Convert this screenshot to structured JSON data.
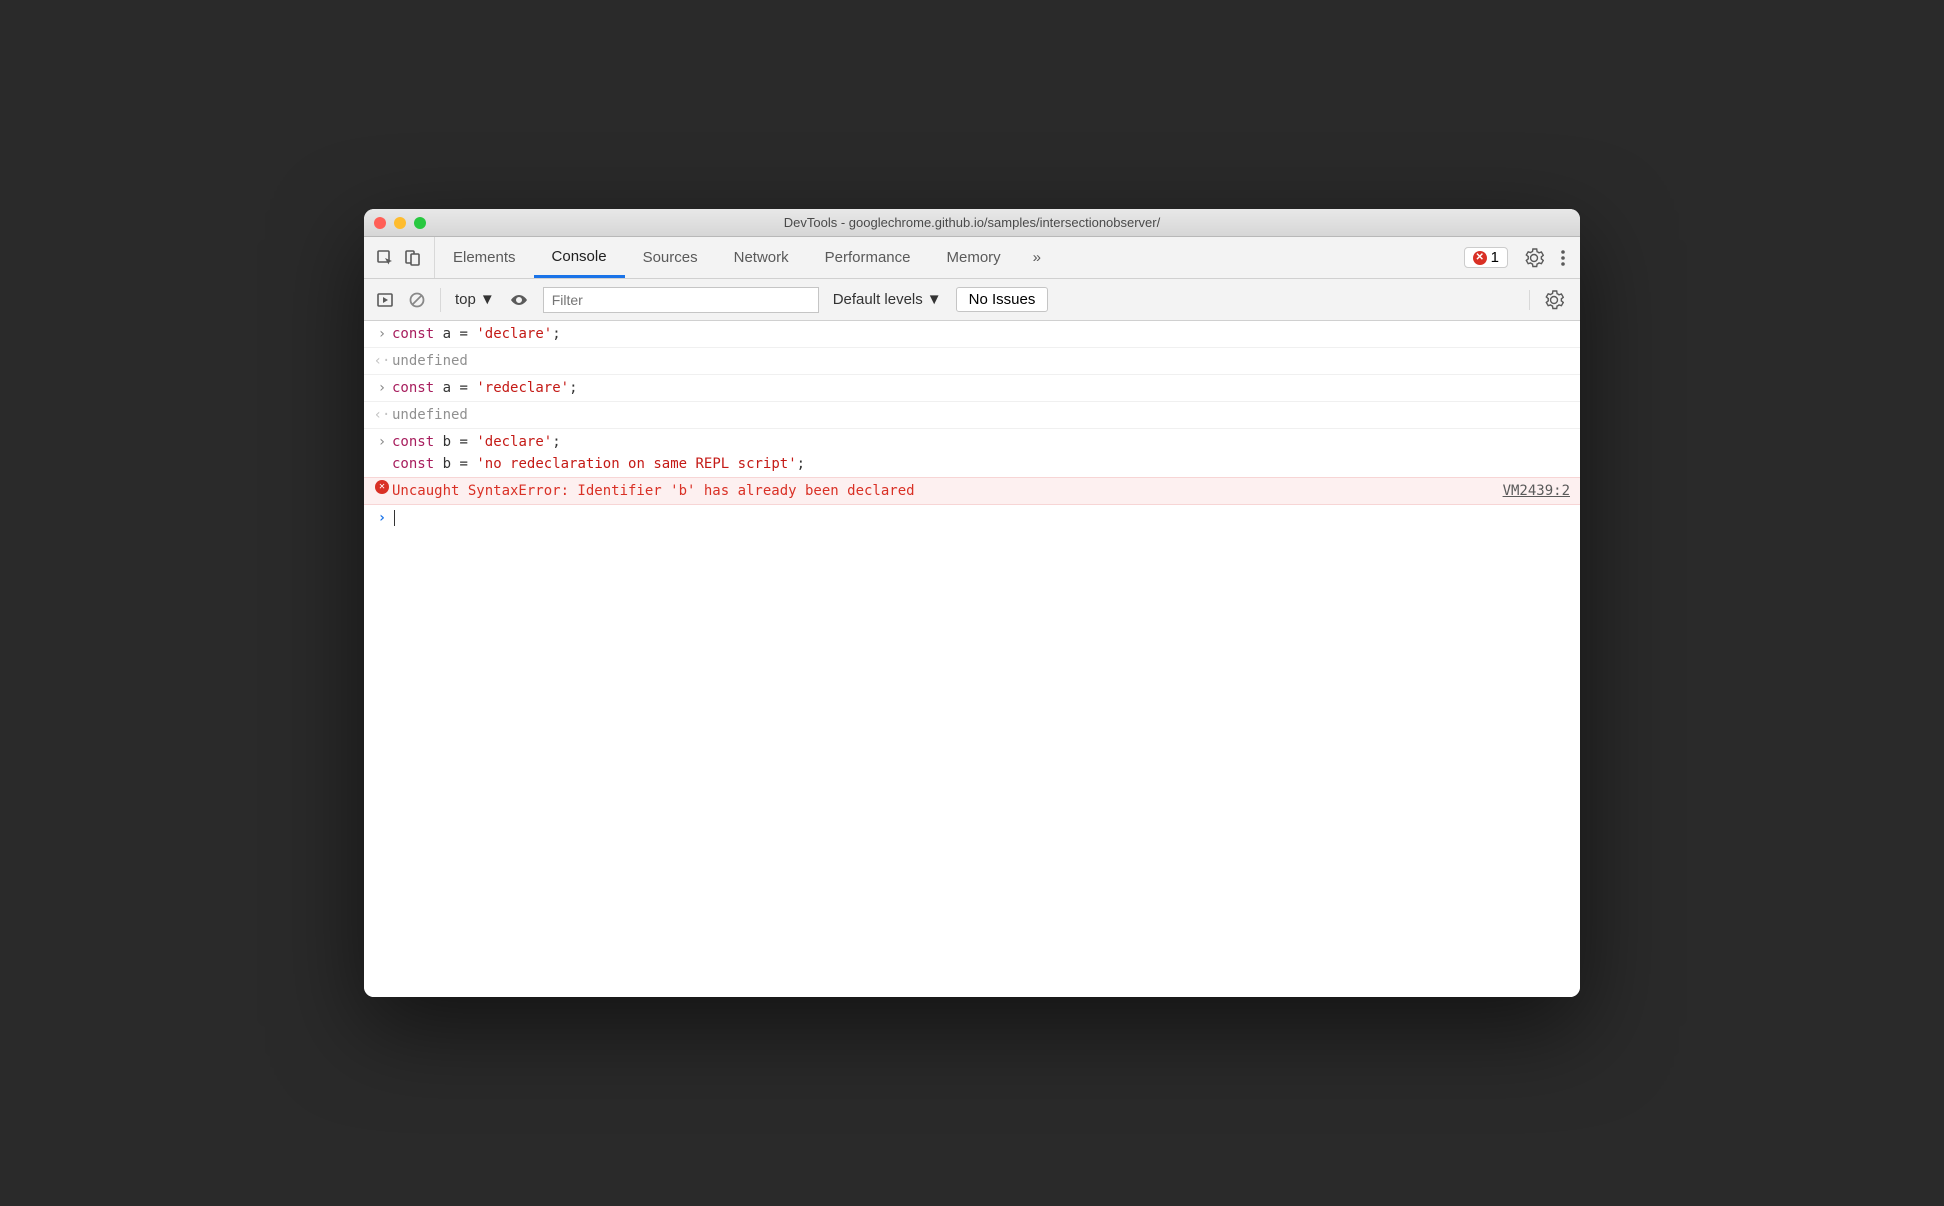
{
  "window": {
    "title": "DevTools - googlechrome.github.io/samples/intersectionobserver/"
  },
  "tabs": {
    "elements": "Elements",
    "console": "Console",
    "sources": "Sources",
    "network": "Network",
    "performance": "Performance",
    "memory": "Memory",
    "overflow": "»",
    "error_count": "1"
  },
  "subbar": {
    "context": "top",
    "filter_placeholder": "Filter",
    "levels": "Default levels",
    "issues": "No Issues"
  },
  "console": {
    "lines": [
      {
        "type": "input",
        "tokens": [
          [
            "kw",
            "const"
          ],
          [
            "sp",
            " "
          ],
          [
            "ident",
            "a"
          ],
          [
            "sp",
            " "
          ],
          [
            "op",
            "="
          ],
          [
            "sp",
            " "
          ],
          [
            "str",
            "'declare'"
          ],
          [
            "op",
            ";"
          ]
        ]
      },
      {
        "type": "result",
        "text": "undefined"
      },
      {
        "type": "input",
        "tokens": [
          [
            "kw",
            "const"
          ],
          [
            "sp",
            " "
          ],
          [
            "ident",
            "a"
          ],
          [
            "sp",
            " "
          ],
          [
            "op",
            "="
          ],
          [
            "sp",
            " "
          ],
          [
            "str",
            "'redeclare'"
          ],
          [
            "op",
            ";"
          ]
        ]
      },
      {
        "type": "result",
        "text": "undefined"
      },
      {
        "type": "input-multi",
        "lines_tokens": [
          [
            [
              "kw",
              "const"
            ],
            [
              "sp",
              " "
            ],
            [
              "ident",
              "b"
            ],
            [
              "sp",
              " "
            ],
            [
              "op",
              "="
            ],
            [
              "sp",
              " "
            ],
            [
              "str",
              "'declare'"
            ],
            [
              "op",
              ";"
            ]
          ],
          [
            [
              "kw",
              "const"
            ],
            [
              "sp",
              " "
            ],
            [
              "ident",
              "b"
            ],
            [
              "sp",
              " "
            ],
            [
              "op",
              "="
            ],
            [
              "sp",
              " "
            ],
            [
              "str",
              "'no redeclaration on same REPL script'"
            ],
            [
              "op",
              ";"
            ]
          ]
        ]
      },
      {
        "type": "error",
        "text": "Uncaught SyntaxError: Identifier 'b' has already been declared",
        "source": "VM2439:2"
      },
      {
        "type": "prompt"
      }
    ]
  }
}
